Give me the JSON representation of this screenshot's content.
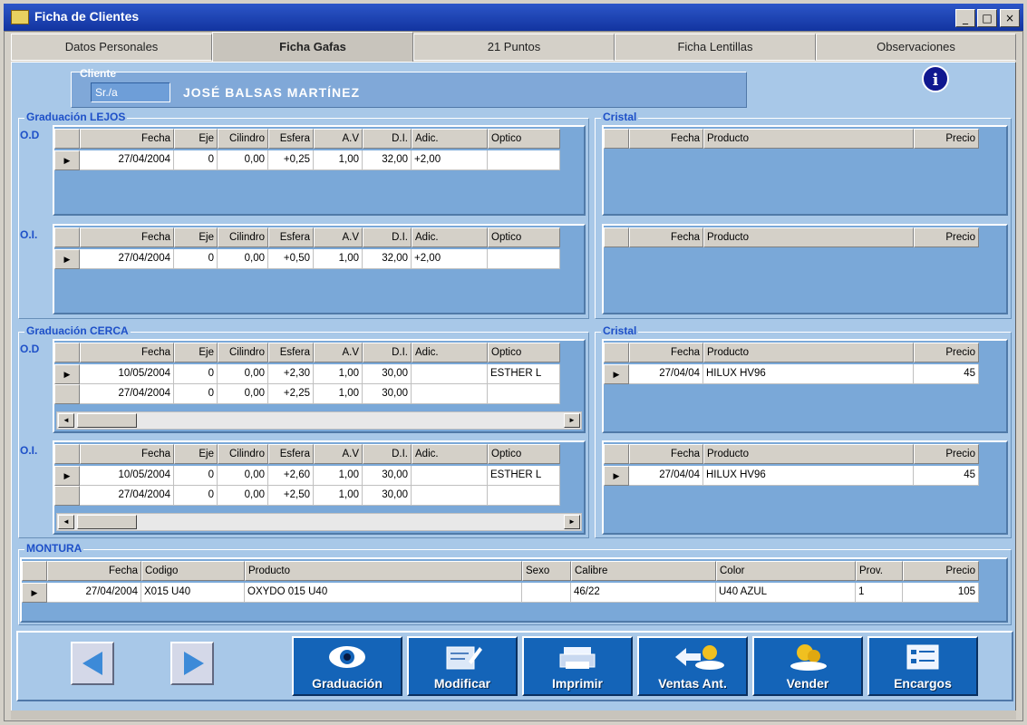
{
  "window": {
    "title": "Ficha de Clientes",
    "controls": [
      "_",
      "□",
      "×"
    ]
  },
  "tabs": [
    {
      "label": "Datos Personales",
      "active": false
    },
    {
      "label": "Ficha Gafas",
      "active": true
    },
    {
      "label": "21 Puntos",
      "active": false
    },
    {
      "label": "Ficha Lentillas",
      "active": false
    },
    {
      "label": "Observaciones",
      "active": false
    }
  ],
  "cliente": {
    "label": "Cliente",
    "code": "Sr./a",
    "name": "JOSÉ BALSAS MARTÍNEZ"
  },
  "graduacion_lejos": {
    "title": "Graduación LEJOS",
    "od_label": "O.D",
    "oi_label": "O.I.",
    "headers": [
      "Fecha",
      "Eje",
      "Cilindro",
      "Esfera",
      "A.V",
      "D.I.",
      "Adic.",
      "Optico"
    ],
    "od_rows": [
      [
        "27/04/2004",
        "0",
        "0,00",
        "+0,25",
        "1,00",
        "32,00",
        "+2,00",
        ""
      ]
    ],
    "oi_rows": [
      [
        "27/04/2004",
        "0",
        "0,00",
        "+0,50",
        "1,00",
        "32,00",
        "+2,00",
        ""
      ]
    ]
  },
  "cristal_lejos": {
    "title": "Cristal",
    "headers": [
      "Fecha",
      "Producto",
      "Precio"
    ],
    "od_rows": [],
    "oi_rows": []
  },
  "graduacion_cerca": {
    "title": "Graduación CERCA",
    "od_label": "O.D",
    "oi_label": "O.I.",
    "headers": [
      "Fecha",
      "Eje",
      "Cilindro",
      "Esfera",
      "A.V",
      "D.I.",
      "Adic.",
      "Optico"
    ],
    "od_rows": [
      [
        "10/05/2004",
        "0",
        "0,00",
        "+2,30",
        "1,00",
        "30,00",
        "",
        "ESTHER L"
      ],
      [
        "27/04/2004",
        "0",
        "0,00",
        "+2,25",
        "1,00",
        "30,00",
        "",
        ""
      ]
    ],
    "oi_rows": [
      [
        "10/05/2004",
        "0",
        "0,00",
        "+2,60",
        "1,00",
        "30,00",
        "",
        "ESTHER L"
      ],
      [
        "27/04/2004",
        "0",
        "0,00",
        "+2,50",
        "1,00",
        "30,00",
        "",
        ""
      ]
    ]
  },
  "cristal_cerca": {
    "title": "Cristal",
    "headers": [
      "Fecha",
      "Producto",
      "Precio"
    ],
    "od_rows": [
      [
        "27/04/04",
        "HILUX HV96",
        "45"
      ]
    ],
    "oi_rows": [
      [
        "27/04/04",
        "HILUX HV96",
        "45"
      ]
    ]
  },
  "montura": {
    "title": "MONTURA",
    "headers": [
      "Fecha",
      "Codigo",
      "Producto",
      "Sexo",
      "Calibre",
      "Color",
      "Prov.",
      "Precio"
    ],
    "rows": [
      [
        "27/04/2004",
        "X015 U40",
        "OXYDO 015 U40",
        "",
        "46/22",
        "U40 AZUL",
        "1",
        "105"
      ]
    ]
  },
  "scroll_arrows": {
    "left": "◄",
    "right": "►"
  },
  "row_marker": "▶",
  "info_glyph": "i",
  "actions": [
    "Graduación",
    "Modificar",
    "Imprimir",
    "Ventas Ant.",
    "Vender",
    "Encargos"
  ]
}
